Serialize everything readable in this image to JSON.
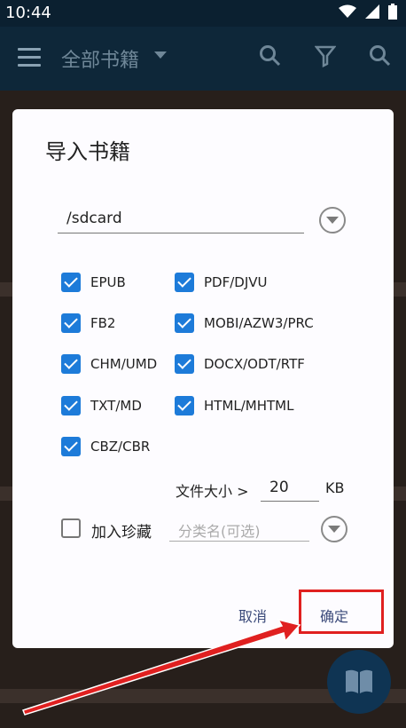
{
  "status": {
    "time": "10:44"
  },
  "toolbar": {
    "title": "全部书籍"
  },
  "dialog": {
    "title": "导入书籍",
    "path": "/sdcard",
    "formats": [
      {
        "label": "EPUB",
        "checked": true
      },
      {
        "label": "PDF/DJVU",
        "checked": true
      },
      {
        "label": "FB2",
        "checked": true
      },
      {
        "label": "MOBI/AZW3/PRC",
        "checked": true
      },
      {
        "label": "CHM/UMD",
        "checked": true
      },
      {
        "label": "DOCX/ODT/RTF",
        "checked": true
      },
      {
        "label": "TXT/MD",
        "checked": true
      },
      {
        "label": "HTML/MHTML",
        "checked": true
      },
      {
        "label": "CBZ/CBR",
        "checked": true
      }
    ],
    "size_label": "文件大小 >",
    "size_value": "20",
    "size_unit": "KB",
    "favorite_label": "加入珍藏",
    "favorite_checked": false,
    "category_placeholder": "分类名(可选)",
    "cancel_label": "取消",
    "confirm_label": "确定"
  },
  "colors": {
    "accent": "#1d7bd9",
    "highlight": "#e02020",
    "button_text": "#3b4a7a"
  },
  "icons": [
    "menu-icon",
    "search-icon",
    "filter-icon",
    "book-icon",
    "wifi-icon",
    "battery-icon"
  ]
}
